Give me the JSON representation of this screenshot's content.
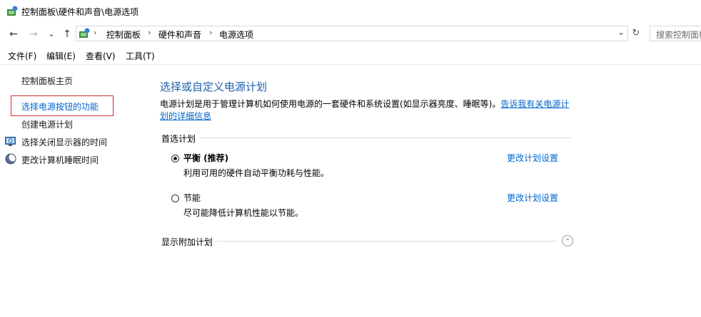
{
  "window": {
    "title": "控制面板\\硬件和声音\\电源选项",
    "icon": "control-panel-icon"
  },
  "nav": {
    "back_icon": "←",
    "forward_icon": "→",
    "recent_icon": "⌄",
    "up_icon": "↑"
  },
  "address": {
    "crumbs": [
      "控制面板",
      "硬件和声音",
      "电源选项"
    ],
    "separator": "›",
    "dropdown_icon": "⌄",
    "refresh_icon": "↻"
  },
  "search": {
    "placeholder": "搜索控制面板"
  },
  "menu": {
    "items": [
      "文件(F)",
      "编辑(E)",
      "查看(V)",
      "工具(T)"
    ]
  },
  "sidebar": {
    "items": [
      {
        "label": "控制面板主页"
      },
      {
        "label": "选择电源按钮的功能"
      },
      {
        "label": "创建电源计划"
      },
      {
        "label": "选择关闭显示器的时间"
      },
      {
        "label": "更改计算机睡眠时间"
      }
    ]
  },
  "main": {
    "heading": "选择或自定义电源计划",
    "description": "电源计划是用于管理计算机如何使用电源的一套硬件和系统设置(如显示器亮度、睡眠等)。",
    "description_link": "告诉我有关电源计划的详细信息",
    "preferred_group": "首选计划",
    "plans": [
      {
        "name": "平衡 (推荐)",
        "desc": "利用可用的硬件自动平衡功耗与性能。",
        "link": "更改计划设置",
        "selected": true
      },
      {
        "name": "节能",
        "desc": "尽可能降低计算机性能以节能。",
        "link": "更改计划设置",
        "selected": false
      }
    ],
    "additional_group": "显示附加计划",
    "expand_icon": "⌄"
  },
  "colors": {
    "link": "#0066cc",
    "heading": "#1e5fa8",
    "highlight_box": "#d32f2f"
  }
}
